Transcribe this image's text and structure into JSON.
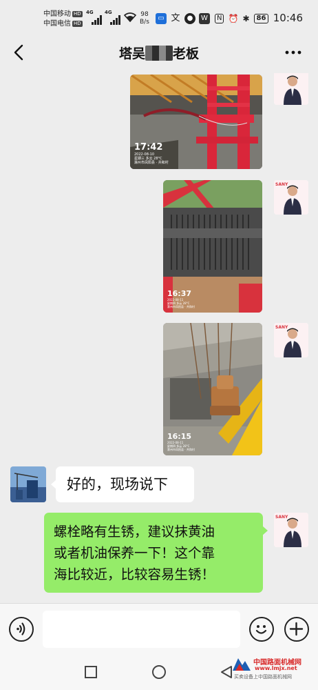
{
  "status_bar": {
    "carrier_1": "中国移动",
    "carrier_2": "中国电信",
    "hd_badge": "HD",
    "network_1": "4G",
    "network_2": "4G",
    "speed_value": "98",
    "speed_unit": "B/s",
    "battery": "86",
    "time": "10:46",
    "icons": [
      "signal-icon",
      "wifi-icon",
      "cmb-app-icon",
      "translate-icon",
      "vpn-icon",
      "game-icon",
      "nfc-icon",
      "alarm-icon",
      "bluetooth-icon",
      "battery-icon"
    ]
  },
  "header": {
    "title_prefix": "塔吴",
    "title_suffix": "老板"
  },
  "messages": [
    {
      "type": "image",
      "sender": "self",
      "stamp_time": "17:42",
      "stamp_date": "2022-08-10",
      "stamp_weekday": "星期三 多云 28°C",
      "stamp_location": "滁州市凤阳县 · 共和村"
    },
    {
      "type": "image",
      "sender": "self",
      "stamp_time": "16:37",
      "stamp_date": "2022-08-11",
      "stamp_weekday": "星期四 多云 28°C",
      "stamp_location": "滁州市凤阳县 · 共和村"
    },
    {
      "type": "image",
      "sender": "self",
      "stamp_time": "16:15",
      "stamp_date": "2022-08-11",
      "stamp_weekday": "星期四 多云 28°C",
      "stamp_location": "滁州市凤阳县 · 共和村"
    },
    {
      "type": "text",
      "sender": "other",
      "text": "好的，现场说下"
    },
    {
      "type": "text",
      "sender": "self",
      "line_1": "螺栓略有生锈，建议抹黄油",
      "line_2": "或者机油保养一下！这个靠",
      "line_3": "海比较近，比较容易生锈！"
    }
  ],
  "avatar_badge": "SANY",
  "input_bar": {
    "voice_icon": "voice-icon",
    "emoji_icon": "emoji-icon",
    "plus_icon": "plus-icon"
  },
  "watermark": {
    "name": "中国路面机械网",
    "url": "www.lmjx.net",
    "tagline": "买卖设备上中国路面机械网"
  },
  "colors": {
    "outgoing_bubble": "#95ec69",
    "incoming_bubble": "#ffffff",
    "background": "#ededed"
  }
}
